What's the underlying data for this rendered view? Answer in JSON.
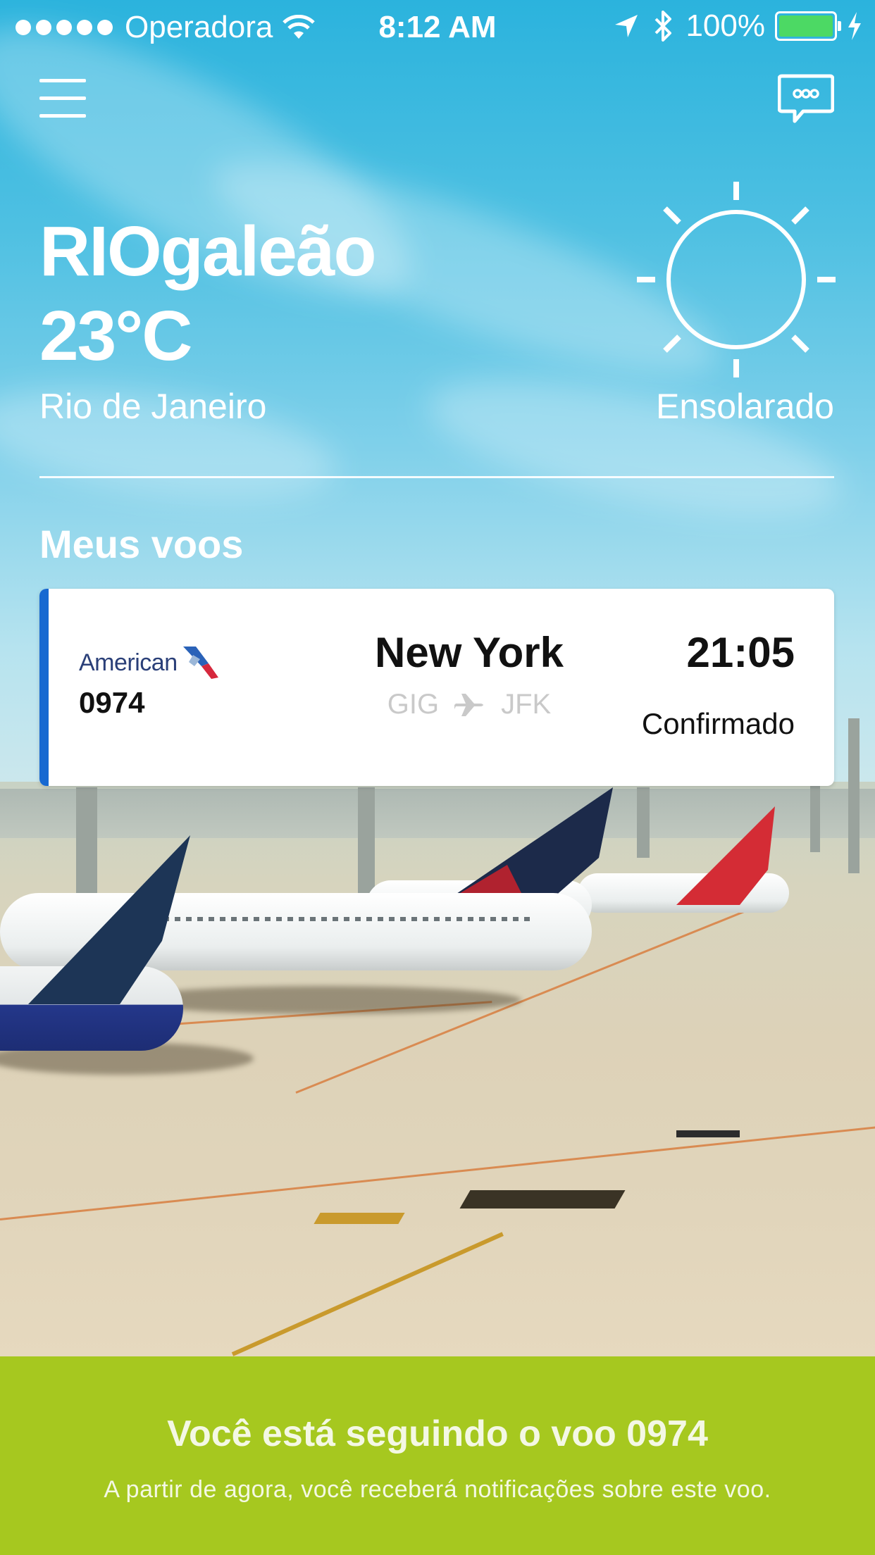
{
  "status_bar": {
    "carrier": "Operadora",
    "time": "8:12 AM",
    "battery": "100%",
    "signal_dots": 5
  },
  "nav": {
    "menu_icon": "hamburger-menu-icon",
    "chat_icon": "chat-bubble-icon"
  },
  "weather": {
    "airport": "RIOgaleão",
    "temperature": "23°C",
    "city": "Rio de Janeiro",
    "condition": "Ensolarado",
    "condition_icon": "sun-icon"
  },
  "flights_section": {
    "title": "Meus voos",
    "flights": [
      {
        "airline": "American",
        "number": "0974",
        "destination": "New York",
        "origin_code": "GIG",
        "destination_code": "JFK",
        "time": "21:05",
        "status": "Confirmado"
      }
    ]
  },
  "banner": {
    "title": "Você está seguindo o voo  0974",
    "text": "A partir de agora, você receberá notificações sobre este voo."
  },
  "colors": {
    "card_accent": "#1769d1",
    "banner_bg": "#a6c81f",
    "battery_fill": "#4cd964"
  }
}
